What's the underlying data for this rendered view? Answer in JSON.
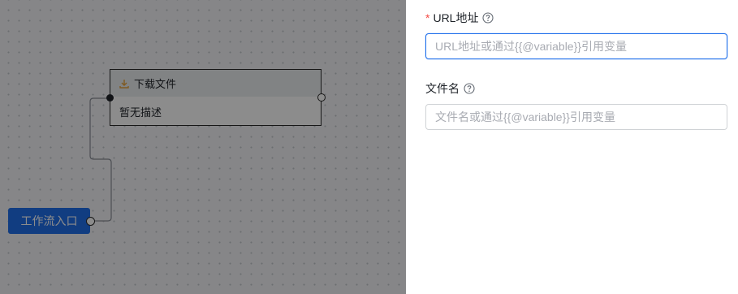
{
  "canvas": {
    "download_node": {
      "title": "下载文件",
      "description": "暂无描述",
      "icon": "download-icon"
    },
    "entry_node": {
      "label": "工作流入口"
    }
  },
  "drawer": {
    "url_field": {
      "label": "URL地址",
      "required": true,
      "required_mark": "*",
      "placeholder": "URL地址或通过{{@variable}}引用变量",
      "value": "",
      "icon": "help-circle-icon"
    },
    "filename_field": {
      "label": "文件名",
      "required": false,
      "placeholder": "文件名或通过{{@variable}}引用变量",
      "value": "",
      "icon": "help-circle-icon"
    }
  },
  "colors": {
    "accent": "#1f6feb",
    "required": "#f54a45",
    "download_icon": "#e8a33d"
  }
}
